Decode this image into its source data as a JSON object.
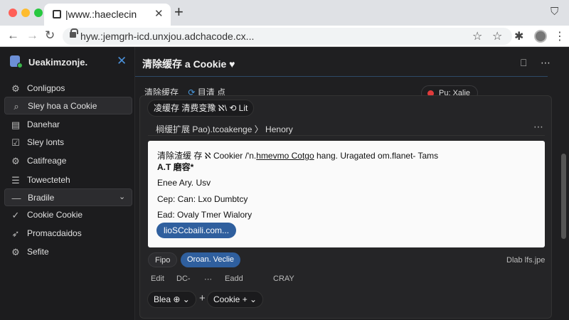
{
  "browser": {
    "tab_title": "|www.:haeclecin",
    "url": "hyw.:jemgrh-icd.unxjou.adchacode.cx..."
  },
  "sidebar": {
    "title": "Ueakimzonje.",
    "items": [
      {
        "label": "Conligpos",
        "icon": "gear-icon"
      },
      {
        "label": "Sley hoa a Cookie",
        "icon": "search-icon"
      },
      {
        "label": "Danehar",
        "icon": "file-icon"
      },
      {
        "label": "Sley lonts",
        "icon": "check-icon"
      },
      {
        "label": "Catifreage",
        "icon": "settings-icon"
      },
      {
        "label": "Towecteteh",
        "icon": "list-icon"
      },
      {
        "label": "Bradile",
        "icon": "dash-icon"
      },
      {
        "label": "Cookie Cookie",
        "icon": "check-circle-icon"
      },
      {
        "label": "Promacdaidos",
        "icon": "rocket-icon"
      },
      {
        "label": "Sefite",
        "icon": "cog-icon"
      }
    ]
  },
  "main": {
    "title": "清除缓存 a Cookie ♥",
    "sub_left": "清除缓存",
    "sub_sync": "目清 点",
    "pill_red": "Pu: Xalie",
    "toolbar_chip": "凌缓存  清费变豫  ℵ\\  ⟲  Lit",
    "history": "㭣缓扩展 Pao).tcoakenge 〉 Henory",
    "card": {
      "line1_a": "清除渣缓 存 ℵ Cookier /'n.",
      "line1_u": "hmevmo Cotgo",
      "line1_b": " hang. Uragated om.flanet- Tams",
      "line2": "A.T 磨容*",
      "line3": "Enee Ary. Usv",
      "line4": "Cep: Can: Lxo Dumbtcy",
      "line5": "Ead: Ovaly Tmer Wialory",
      "link": "lioSCcbaili.com..."
    },
    "chip_left": "Fipo",
    "chip_right": "Oroan. Veclie",
    "date_right": "Dlab lfs.jpe",
    "small": [
      "Edit",
      "DC-",
      "⋯",
      "Eadd",
      "CRAY"
    ],
    "bottom_chip1": "Blea ⊕ ⌄",
    "bottom_chip2": "Cookie + ⌄"
  }
}
